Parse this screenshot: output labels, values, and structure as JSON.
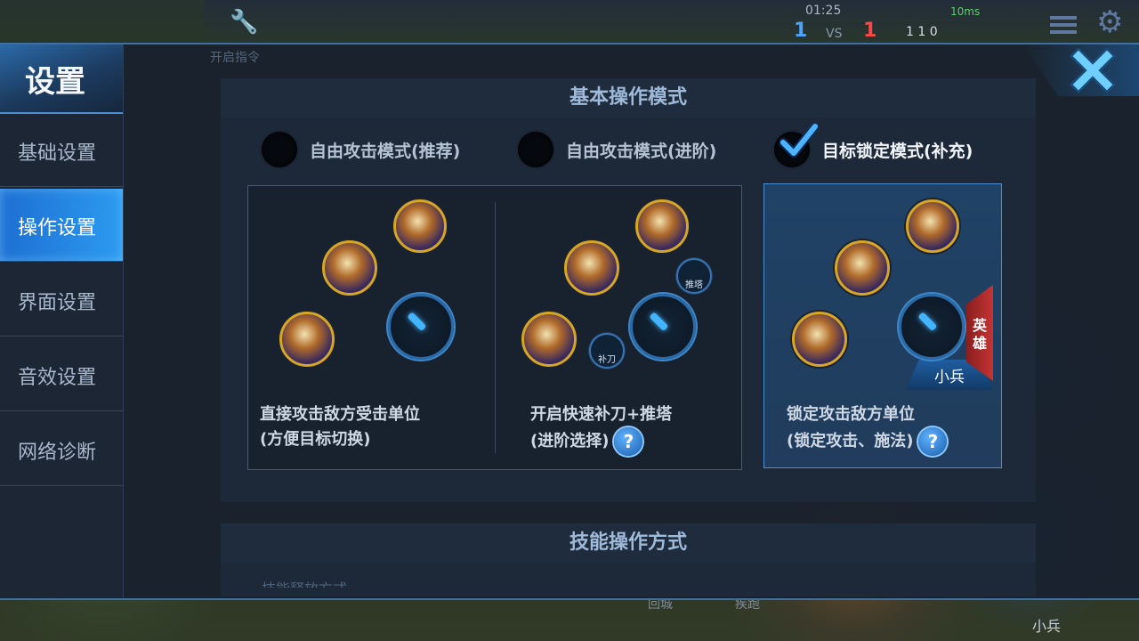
{
  "hud": {
    "time": "01:25",
    "signal": "10ms",
    "score_left": "1",
    "vs": "VS",
    "score_right": "1",
    "kda": "1   1   0"
  },
  "background": {
    "faded_label": "开启指令",
    "bottom_buttons": [
      "回城",
      "疾跑",
      "小兵"
    ]
  },
  "sidebar": {
    "title": "设置",
    "items": [
      {
        "label": "基础设置",
        "active": false
      },
      {
        "label": "操作设置",
        "active": true
      },
      {
        "label": "界面设置",
        "active": false
      },
      {
        "label": "音效设置",
        "active": false
      },
      {
        "label": "网络诊断",
        "active": false
      }
    ]
  },
  "basic_mode": {
    "title": "基本操作模式",
    "options": [
      {
        "label": "自由攻击模式(推荐)",
        "selected": false,
        "desc_line1": "直接攻击敌方受击单位",
        "desc_line2": "(方便目标切换)"
      },
      {
        "label": "自由攻击模式(进阶)",
        "selected": false,
        "desc_line1": "开启快速补刀+推塔",
        "desc_line2": "(进阶选择)"
      },
      {
        "label": "目标锁定模式(补充)",
        "selected": true,
        "desc_line1": "锁定攻击敌方单位",
        "desc_line2": "(锁定攻击、施法)"
      }
    ],
    "mini_buttons": {
      "push_tower": "推塔",
      "last_hit": "补刀"
    },
    "lock_tabs": {
      "minion": "小兵",
      "hero": "英雄"
    },
    "help_glyph": "?"
  },
  "skill_mode": {
    "title": "技能操作方式",
    "sub_label": "技能释放方式"
  },
  "colors": {
    "accent": "#2c9bf0",
    "selected_card": "#1f4266",
    "hero_tab": "#c53434"
  }
}
